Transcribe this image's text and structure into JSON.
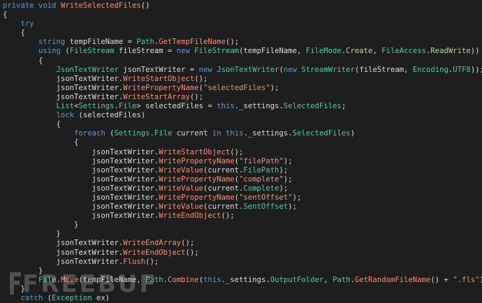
{
  "editor": {
    "lines": [
      [
        [
          "kw",
          "private"
        ],
        [
          "punc",
          " "
        ],
        [
          "kw",
          "void"
        ],
        [
          "punc",
          " "
        ],
        [
          "meth",
          "WriteSelectedFiles"
        ],
        [
          "punc",
          "()"
        ]
      ],
      [
        [
          "punc",
          "{"
        ]
      ],
      [
        [
          "punc",
          "    "
        ],
        [
          "kw",
          "try"
        ]
      ],
      [
        [
          "punc",
          "    {"
        ]
      ],
      [
        [
          "punc",
          "        "
        ],
        [
          "kw",
          "string"
        ],
        [
          "punc",
          " tempFileName = "
        ],
        [
          "type",
          "Path"
        ],
        [
          "punc",
          "."
        ],
        [
          "meth",
          "GetTempFileName"
        ],
        [
          "punc",
          "();"
        ]
      ],
      [
        [
          "punc",
          "        "
        ],
        [
          "kw",
          "using"
        ],
        [
          "punc",
          " ("
        ],
        [
          "type",
          "FileStream"
        ],
        [
          "punc",
          " fileStream = "
        ],
        [
          "kw",
          "new"
        ],
        [
          "punc",
          " "
        ],
        [
          "type",
          "FileStream"
        ],
        [
          "punc",
          "(tempFileName, "
        ],
        [
          "type",
          "FileMode"
        ],
        [
          "punc",
          "."
        ],
        [
          "enum",
          "Create"
        ],
        [
          "punc",
          ", "
        ],
        [
          "type",
          "FileAccess"
        ],
        [
          "punc",
          "."
        ],
        [
          "enum",
          "ReadWrite"
        ],
        [
          "punc",
          "))"
        ]
      ],
      [
        [
          "punc",
          "        {"
        ]
      ],
      [
        [
          "punc",
          "            "
        ],
        [
          "type",
          "JsonTextWriter"
        ],
        [
          "punc",
          " jsonTextWriter = "
        ],
        [
          "kw",
          "new"
        ],
        [
          "punc",
          " "
        ],
        [
          "type",
          "JsonTextWriter"
        ],
        [
          "punc",
          "("
        ],
        [
          "kw",
          "new"
        ],
        [
          "punc",
          " "
        ],
        [
          "type",
          "StreamWriter"
        ],
        [
          "punc",
          "(fileStream, "
        ],
        [
          "type",
          "Encoding"
        ],
        [
          "punc",
          "."
        ],
        [
          "prop",
          "UTF8"
        ],
        [
          "punc",
          "));"
        ]
      ],
      [
        [
          "punc",
          "            jsonTextWriter."
        ],
        [
          "meth",
          "WriteStartObject"
        ],
        [
          "punc",
          "();"
        ]
      ],
      [
        [
          "punc",
          "            jsonTextWriter."
        ],
        [
          "meth",
          "WritePropertyName"
        ],
        [
          "punc",
          "("
        ],
        [
          "str",
          "\"selectedFiles\""
        ],
        [
          "punc",
          ");"
        ]
      ],
      [
        [
          "punc",
          "            jsonTextWriter."
        ],
        [
          "meth",
          "WriteStartArray"
        ],
        [
          "punc",
          "();"
        ]
      ],
      [
        [
          "punc",
          "            "
        ],
        [
          "type",
          "List"
        ],
        [
          "punc",
          "<"
        ],
        [
          "type",
          "Settings"
        ],
        [
          "punc",
          "."
        ],
        [
          "type",
          "File"
        ],
        [
          "punc",
          "> selectedFiles = "
        ],
        [
          "kw",
          "this"
        ],
        [
          "punc",
          "._settings."
        ],
        [
          "prop",
          "SelectedFiles"
        ],
        [
          "punc",
          ";"
        ]
      ],
      [
        [
          "punc",
          "            "
        ],
        [
          "kw",
          "lock"
        ],
        [
          "punc",
          " (selectedFiles)"
        ]
      ],
      [
        [
          "punc",
          "            {"
        ]
      ],
      [
        [
          "punc",
          "                "
        ],
        [
          "kw",
          "foreach"
        ],
        [
          "punc",
          " ("
        ],
        [
          "type",
          "Settings"
        ],
        [
          "punc",
          "."
        ],
        [
          "type",
          "File"
        ],
        [
          "punc",
          " current "
        ],
        [
          "kw",
          "in"
        ],
        [
          "punc",
          " "
        ],
        [
          "kw",
          "this"
        ],
        [
          "punc",
          "._settings."
        ],
        [
          "prop",
          "SelectedFiles"
        ],
        [
          "punc",
          ")"
        ]
      ],
      [
        [
          "punc",
          "                {"
        ]
      ],
      [
        [
          "punc",
          "                    jsonTextWriter."
        ],
        [
          "meth",
          "WriteStartObject"
        ],
        [
          "punc",
          "();"
        ]
      ],
      [
        [
          "punc",
          "                    jsonTextWriter."
        ],
        [
          "meth",
          "WritePropertyName"
        ],
        [
          "punc",
          "("
        ],
        [
          "str",
          "\"filePath\""
        ],
        [
          "punc",
          ");"
        ]
      ],
      [
        [
          "punc",
          "                    jsonTextWriter."
        ],
        [
          "meth",
          "WriteValue"
        ],
        [
          "punc",
          "(current."
        ],
        [
          "prop",
          "FilePath"
        ],
        [
          "punc",
          ");"
        ]
      ],
      [
        [
          "punc",
          "                    jsonTextWriter."
        ],
        [
          "meth",
          "WritePropertyName"
        ],
        [
          "punc",
          "("
        ],
        [
          "str",
          "\"complete\""
        ],
        [
          "punc",
          ");"
        ]
      ],
      [
        [
          "punc",
          "                    jsonTextWriter."
        ],
        [
          "meth",
          "WriteValue"
        ],
        [
          "punc",
          "(current."
        ],
        [
          "prop",
          "Complete"
        ],
        [
          "punc",
          ");"
        ]
      ],
      [
        [
          "punc",
          "                    jsonTextWriter."
        ],
        [
          "meth",
          "WritePropertyName"
        ],
        [
          "punc",
          "("
        ],
        [
          "str",
          "\"sentOffset\""
        ],
        [
          "punc",
          ");"
        ]
      ],
      [
        [
          "punc",
          "                    jsonTextWriter."
        ],
        [
          "meth",
          "WriteValue"
        ],
        [
          "punc",
          "(current."
        ],
        [
          "prop",
          "SentOffset"
        ],
        [
          "punc",
          ");"
        ]
      ],
      [
        [
          "punc",
          "                    jsonTextWriter."
        ],
        [
          "meth",
          "WriteEndObject"
        ],
        [
          "punc",
          "();"
        ]
      ],
      [
        [
          "punc",
          "                }"
        ]
      ],
      [
        [
          "punc",
          "            }"
        ]
      ],
      [
        [
          "punc",
          "            jsonTextWriter."
        ],
        [
          "meth",
          "WriteEndArray"
        ],
        [
          "punc",
          "();"
        ]
      ],
      [
        [
          "punc",
          "            jsonTextWriter."
        ],
        [
          "meth",
          "WriteEndObject"
        ],
        [
          "punc",
          "();"
        ]
      ],
      [
        [
          "punc",
          "            jsonTextWriter."
        ],
        [
          "meth",
          "Flush"
        ],
        [
          "punc",
          "();"
        ]
      ],
      [
        [
          "punc",
          "        }"
        ]
      ],
      [
        [
          "punc",
          "        "
        ],
        [
          "type",
          "File"
        ],
        [
          "punc",
          "."
        ],
        [
          "meth",
          "Move"
        ],
        [
          "punc",
          "(tempFileName, "
        ],
        [
          "type",
          "Path"
        ],
        [
          "punc",
          "."
        ],
        [
          "meth",
          "Combine"
        ],
        [
          "punc",
          "("
        ],
        [
          "kw",
          "this"
        ],
        [
          "punc",
          "._settings."
        ],
        [
          "prop",
          "OutputFolder"
        ],
        [
          "punc",
          ", "
        ],
        [
          "type",
          "Path"
        ],
        [
          "punc",
          "."
        ],
        [
          "meth",
          "GetRandomFileName"
        ],
        [
          "punc",
          "() + "
        ],
        [
          "str",
          "\".fls\""
        ],
        [
          "punc",
          "));"
        ]
      ],
      [
        [
          "punc",
          "    }"
        ]
      ],
      [
        [
          "punc",
          "    "
        ],
        [
          "kw",
          "catch"
        ],
        [
          "punc",
          " ("
        ],
        [
          "type",
          "Exception"
        ],
        [
          "punc",
          " ex)"
        ]
      ]
    ]
  },
  "watermark": {
    "text": "FREEBUF"
  },
  "colors": {
    "background": "#1e1e1e",
    "keyword": "#569cd6",
    "type": "#4ec9b0",
    "method": "#ff8c6b",
    "string": "#d69d85",
    "enum": "#b8d7a3",
    "text": "#dcdcdc"
  }
}
